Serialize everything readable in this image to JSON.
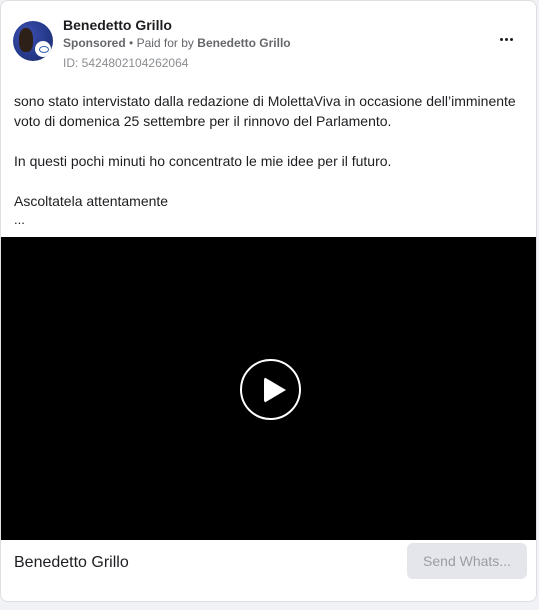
{
  "ad": {
    "advertiser_name": "Benedetto Grillo",
    "sponsored_label": "Sponsored",
    "paid_for_prefix": "Paid for by",
    "paid_for_name": "Benedetto Grillo",
    "ad_id": "ID: 5424802104262064",
    "more_icon": "more-horizontal-icon"
  },
  "body": {
    "paragraph_1": "sono stato intervistato dalla redazione di MolettaViva in occasione dell’imminente",
    "paragraph_1b": "voto di domenica 25 settembre per il rinnovo del Parlamento.",
    "paragraph_2": "In questi pochi minuti ho concentrato le mie idee per il futuro.",
    "paragraph_3": "Ascoltatela attentamente",
    "ellipsis": "..."
  },
  "video": {
    "play_icon": "play-icon",
    "background_color": "#000000"
  },
  "footer": {
    "title": "Benedetto Grillo",
    "cta_label": "Send Whats..."
  },
  "colors": {
    "text_primary": "#1c1e21",
    "text_secondary": "#65676b",
    "button_bg": "#e4e6eb",
    "button_text": "#9a9da2"
  }
}
